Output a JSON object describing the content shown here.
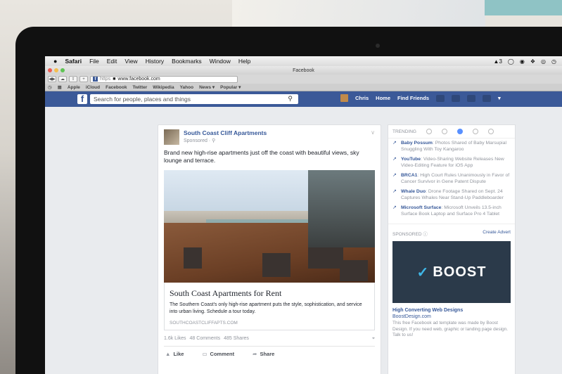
{
  "menubar": {
    "app": "Safari",
    "items": [
      "File",
      "Edit",
      "View",
      "History",
      "Bookmarks",
      "Window",
      "Help"
    ],
    "status": [
      "3"
    ]
  },
  "window": {
    "title": "Facebook"
  },
  "toolbar": {
    "url_scheme": "https",
    "url": "www.facebook.com",
    "favicon": "f"
  },
  "bookmarks": [
    "Apple",
    "iCloud",
    "Facebook",
    "Twitter",
    "Wikipedia",
    "Yahoo",
    "News ▾",
    "Popular ▾"
  ],
  "facebook_header": {
    "logo": "f",
    "search_placeholder": "Search for people, places and things",
    "user_name": "Chris",
    "home": "Home",
    "find_friends": "Find Friends"
  },
  "post": {
    "page_name": "South Coast Cliff Apartments",
    "sponsored": "Sponsored · ⚲",
    "text": "Brand new high-rise apartments just off the coast with beautiful views, sky lounge and terrace.",
    "link_title": "South Coast Apartments for Rent",
    "link_description": "The Southern Coast's only high-rise apartment puts the style, sophistication, and service into urban living. Schedule a tour today.",
    "link_url": "SOUTHCOASTCLIFFAPTS.COM",
    "stats": {
      "likes": "1.6k Likes",
      "comments": "48 Comments",
      "shares": "485 Shares"
    },
    "actions": {
      "like": "Like",
      "comment": "Comment",
      "share": "Share"
    }
  },
  "trending": {
    "label": "TRENDING",
    "items": [
      {
        "name": "Baby Possum",
        "text": ": Photos Shared of Baby Marsupial Snuggling With Toy Kangaroo"
      },
      {
        "name": "YouTube",
        "text": ": Video-Sharing Website Releases New Video-Editing Feature for iOS App"
      },
      {
        "name": "BRCA1",
        "text": ": High Court Rules Unanimously in Favor of Cancer Survivor in Gene Patent Dispute"
      },
      {
        "name": "Whale Duo",
        "text": ": Drone Footage Shared on Sept. 24 Captures Whales Near Stand-Up Paddleboarder"
      },
      {
        "name": "Microsoft Surface",
        "text": ": Microsoft Unveils 13.5-inch Surface Book Laptop and Surface Pro 4 Tablet"
      }
    ]
  },
  "sponsored_ad": {
    "label": "SPONSORED",
    "create_advert": "Create Advert",
    "brand_text": "BOOST",
    "title": "High Converting Web Designs",
    "subtitle": "BoostDesign.com",
    "description": "This free Facebook ad template was made by Boost Design. If you need web, graphic or landing page design. Talk to us!"
  },
  "colors": {
    "facebook_blue": "#3b5998",
    "link_blue": "#365899",
    "page_bg": "#e9ebee",
    "ad_bg": "#2b3a4a",
    "boost_accent": "#3fb7e8"
  }
}
